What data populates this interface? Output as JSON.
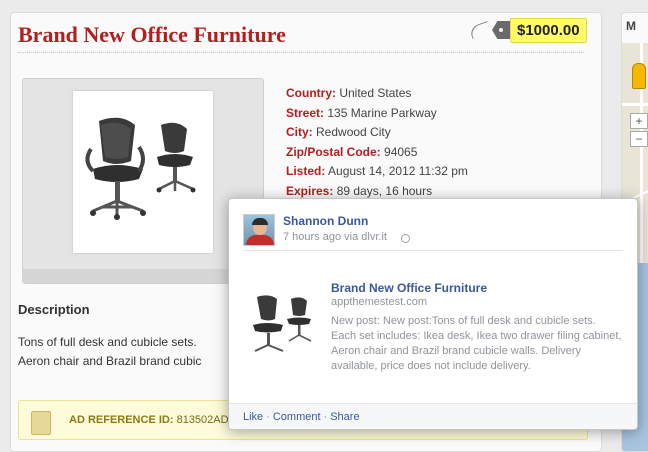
{
  "listing": {
    "title": "Brand New Office Furniture",
    "price": "$1000.00",
    "specs": [
      {
        "key": "Country:",
        "value": "United States"
      },
      {
        "key": "Street:",
        "value": "135 Marine Parkway"
      },
      {
        "key": "City:",
        "value": "Redwood City"
      },
      {
        "key": "Zip/Postal Code:",
        "value": "94065"
      },
      {
        "key": "Listed:",
        "value": "August 14, 2012 11:32 pm"
      },
      {
        "key": "Expires:",
        "value": "89 days, 16 hours"
      }
    ],
    "description_heading": "Description",
    "description_text": "Tons of full desk and cubicle sets. Aeron chair and Brazil brand cubic",
    "ad_reference_label": "AD REFERENCE ID:",
    "ad_reference_value": "813502AD"
  },
  "map": {
    "tab_label": "M",
    "zoom_in": "+",
    "zoom_out": "−",
    "copyright": "©"
  },
  "facebook_post": {
    "author": "Shannon Dunn",
    "meta": "7 hours ago via dlvr.it",
    "link_title": "Brand New Office Furniture",
    "link_domain": "appthemestest.com",
    "link_description": "New post: New post:Tons of full desk and cubicle sets. Each set includes: Ikea desk, Ikea two drawer filing cabinet, Aeron chair and Brazil brand cubicle walls. Delivery available, price does not include delivery.",
    "actions": {
      "like": "Like",
      "comment": "Comment",
      "share": "Share",
      "separator": "·"
    }
  },
  "colors": {
    "accent": "#b51e1e",
    "price_bg": "#fffb66",
    "facebook_blue": "#3b5998"
  },
  "icons": [
    "price-tag-icon",
    "globe-icon",
    "pegman-icon",
    "note-icon"
  ]
}
